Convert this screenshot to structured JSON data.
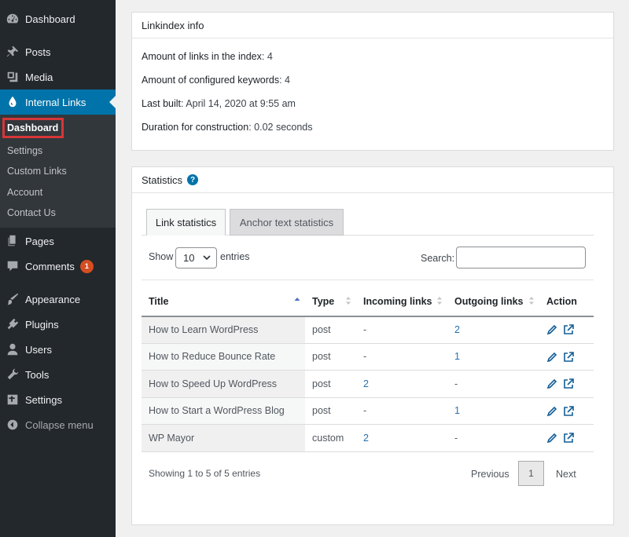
{
  "sidebar": {
    "items": [
      {
        "label": "Dashboard",
        "icon": "dashboard-icon"
      },
      {
        "label": "Posts",
        "icon": "pin-icon"
      },
      {
        "label": "Media",
        "icon": "media-icon"
      },
      {
        "label": "Internal Links",
        "icon": "droplet-icon"
      },
      {
        "label": "Pages",
        "icon": "pages-icon"
      },
      {
        "label": "Comments",
        "icon": "comment-icon",
        "badge": "1"
      },
      {
        "label": "Appearance",
        "icon": "brush-icon"
      },
      {
        "label": "Plugins",
        "icon": "plugin-icon"
      },
      {
        "label": "Users",
        "icon": "user-icon"
      },
      {
        "label": "Tools",
        "icon": "wrench-icon"
      },
      {
        "label": "Settings",
        "icon": "settings-icon"
      },
      {
        "label": "Collapse menu",
        "icon": "collapse-icon"
      }
    ],
    "submenu": [
      "Dashboard",
      "Settings",
      "Custom Links",
      "Account",
      "Contact Us"
    ]
  },
  "info_panel": {
    "title": "Linkindex info",
    "lines": [
      {
        "key": "Amount of links in the index",
        "value": "4"
      },
      {
        "key": "Amount of configured keywords",
        "value": "4"
      },
      {
        "key": "Last built",
        "value": "April 14, 2020 at 9:55 am"
      },
      {
        "key": "Duration for construction",
        "value": "0.02 seconds"
      }
    ]
  },
  "stats_panel": {
    "title": "Statistics",
    "help": "?",
    "tabs": [
      "Link statistics",
      "Anchor text statistics"
    ],
    "show_label": "Show",
    "entries_value": "10",
    "entries_label": "entries",
    "search_label": "Search:",
    "search_value": "",
    "columns": [
      "Title",
      "Type",
      "Incoming links",
      "Outgoing links",
      "Action"
    ],
    "rows": [
      {
        "title": "How to Learn WordPress",
        "type": "post",
        "incoming": "-",
        "outgoing": "2"
      },
      {
        "title": "How to Reduce Bounce Rate",
        "type": "post",
        "incoming": "-",
        "outgoing": "1"
      },
      {
        "title": "How to Speed Up WordPress",
        "type": "post",
        "incoming": "2",
        "outgoing": "-"
      },
      {
        "title": "How to Start a WordPress Blog",
        "type": "post",
        "incoming": "-",
        "outgoing": "1"
      },
      {
        "title": "WP Mayor",
        "type": "custom",
        "incoming": "2",
        "outgoing": "-"
      }
    ],
    "footer_info": "Showing 1 to 5 of 5 entries",
    "previous": "Previous",
    "page": "1",
    "next": "Next"
  },
  "colors": {
    "sidebar_bg": "#23282d",
    "submenu_bg": "#32373c",
    "accent": "#0073aa",
    "highlight_border": "#d63638",
    "badge": "#d54e21",
    "link": "#2271b1"
  }
}
